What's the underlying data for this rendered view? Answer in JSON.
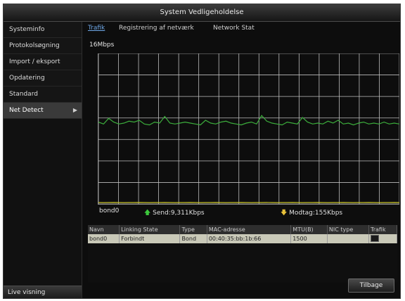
{
  "window": {
    "title": "System Vedligeholdelse"
  },
  "sidebar": {
    "items": [
      {
        "label": "Systeminfo",
        "active": false
      },
      {
        "label": "Protokolsøgning",
        "active": false
      },
      {
        "label": "Import / eksport",
        "active": false
      },
      {
        "label": "Opdatering",
        "active": false
      },
      {
        "label": "Standard",
        "active": false
      },
      {
        "label": "Net Detect",
        "active": true,
        "has_arrow": true
      }
    ],
    "live_view_label": "Live visning"
  },
  "tabs": [
    {
      "label": "Trafik",
      "active": true
    },
    {
      "label": "Registrering af netværk",
      "active": false
    },
    {
      "label": "Network Stat",
      "active": false
    }
  ],
  "graph": {
    "scale_label": "16Mbps",
    "send_color": "#3cae3c",
    "receive_color": "#c9c42a",
    "grid_color": "#bdbdbd",
    "send_series": [
      8.7,
      8.5,
      9.1,
      8.7,
      8.5,
      8.6,
      8.8,
      8.7,
      8.9,
      8.5,
      8.4,
      8.7,
      8.6,
      9.3,
      8.6,
      8.5,
      8.6,
      8.7,
      8.6,
      8.5,
      8.4,
      8.9,
      8.6,
      8.5,
      8.7,
      8.8,
      8.6,
      8.5,
      8.4,
      8.6,
      8.7,
      8.5,
      9.4,
      8.8,
      8.6,
      8.5,
      8.4,
      8.7,
      8.6,
      8.5,
      9.2,
      8.7,
      8.5,
      8.6,
      8.5,
      8.8,
      8.6,
      8.9,
      8.5,
      8.6,
      8.4,
      8.6,
      8.7,
      8.5,
      8.6,
      8.5,
      8.7,
      8.5,
      8.6,
      8.5
    ],
    "receive_series": [
      0.15,
      0.14,
      0.15,
      0.16,
      0.15,
      0.14,
      0.15,
      0.15,
      0.16,
      0.15,
      0.14,
      0.15,
      0.15,
      0.16,
      0.15,
      0.14,
      0.15,
      0.15,
      0.16,
      0.15,
      0.14,
      0.15,
      0.15,
      0.16,
      0.15,
      0.14,
      0.15,
      0.15,
      0.16,
      0.15,
      0.14,
      0.15,
      0.15,
      0.16,
      0.15,
      0.14,
      0.15,
      0.15,
      0.16,
      0.15,
      0.14,
      0.15,
      0.15,
      0.16,
      0.15,
      0.14,
      0.15,
      0.15,
      0.16,
      0.15,
      0.14,
      0.15,
      0.15,
      0.16,
      0.15,
      0.14,
      0.15,
      0.15,
      0.16,
      0.15
    ],
    "y_max": 16
  },
  "status": {
    "interface": "bond0",
    "send": "Send:9,311Kbps",
    "receive": "Modtag:155Kbps",
    "send_arrow_color": "#3cc83c",
    "receive_arrow_color": "#e8c23a"
  },
  "table": {
    "headers": [
      "Navn",
      "Linking State",
      "Type",
      "MAC-adresse",
      "MTU(B)",
      "NIC type",
      "Trafik"
    ],
    "rows": [
      [
        "bond0",
        "Forbindt",
        "Bond",
        "00:40:35:bb:1b:66",
        "1500",
        "",
        ""
      ]
    ]
  },
  "footer": {
    "back_label": "Tilbage"
  }
}
